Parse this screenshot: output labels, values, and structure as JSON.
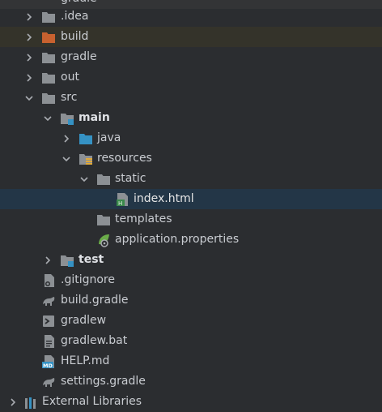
{
  "tree": {
    "top_partial": "gradle",
    "items": [
      {
        "label": ".idea",
        "icon": "folder-icon"
      },
      {
        "label": "build",
        "icon": "folder-excluded-icon"
      },
      {
        "label": "gradle",
        "icon": "folder-icon"
      },
      {
        "label": "out",
        "icon": "folder-icon"
      },
      {
        "label": "src",
        "icon": "folder-icon"
      },
      {
        "label": "main",
        "icon": "module-folder-icon"
      },
      {
        "label": "java",
        "icon": "source-folder-icon"
      },
      {
        "label": "resources",
        "icon": "resources-folder-icon"
      },
      {
        "label": "static",
        "icon": "folder-icon"
      },
      {
        "label": "index.html",
        "icon": "html-file-icon"
      },
      {
        "label": "templates",
        "icon": "folder-icon"
      },
      {
        "label": "application.properties",
        "icon": "spring-properties-icon"
      },
      {
        "label": "test",
        "icon": "module-folder-icon"
      },
      {
        "label": ".gitignore",
        "icon": "gitignore-file-icon"
      },
      {
        "label": "build.gradle",
        "icon": "gradle-file-icon"
      },
      {
        "label": "gradlew",
        "icon": "shell-script-icon"
      },
      {
        "label": "gradlew.bat",
        "icon": "text-file-icon"
      },
      {
        "label": "HELP.md",
        "icon": "markdown-file-icon"
      },
      {
        "label": "settings.gradle",
        "icon": "gradle-file-icon"
      }
    ],
    "bottom_partial": "External Libraries"
  },
  "colors": {
    "background": "#2b2d30",
    "selection": "#233647",
    "excluded_highlight": "#34332a",
    "folder": "#8c9094",
    "excluded_folder": "#c8612f",
    "source_folder": "#3592c4"
  }
}
